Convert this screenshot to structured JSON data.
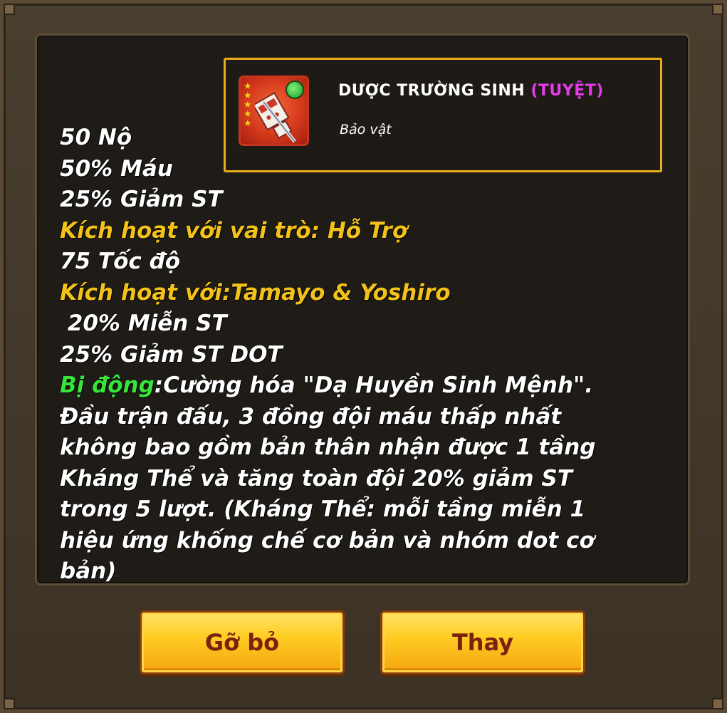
{
  "item": {
    "name": "DƯỢC TRƯỜNG SINH",
    "rarity": "(TUYỆT)",
    "type": "Bảo vật",
    "stars": 5,
    "icon": "medicine-pill-item-icon",
    "gem_icon": "green-gem-icon"
  },
  "stats": {
    "line1": "50 Nộ",
    "line2": "50% Máu",
    "line3": "25% Giảm ST",
    "activate_role": "Kích hoạt với vai trò: Hỗ Trợ",
    "line4": "75 Tốc độ",
    "activate_with": "Kích hoạt với:Tamayo & Yoshiro",
    "line5": " 20% Miễn ST",
    "line6": "25% Giảm ST DOT",
    "passive_label": "Bị động",
    "passive_text": ":Cường hóa \"Dạ Huyền Sinh Mệnh\". Đầu trận đấu, 3 đồng đội máu thấp nhất không bao gồm bản thân nhận được 1 tầng Kháng Thể và tăng toàn đội 20% giảm ST trong 5 lượt. (Kháng Thể: mỗi tầng miễn 1 hiệu ứng khống chế cơ bản và nhóm dot cơ bản)"
  },
  "buttons": {
    "remove": "Gỡ bỏ",
    "replace": "Thay"
  },
  "colors": {
    "rarity": "#e33ce9",
    "highlight": "#f2c21b",
    "passive": "#38e43b",
    "button": "#ffcd24"
  }
}
